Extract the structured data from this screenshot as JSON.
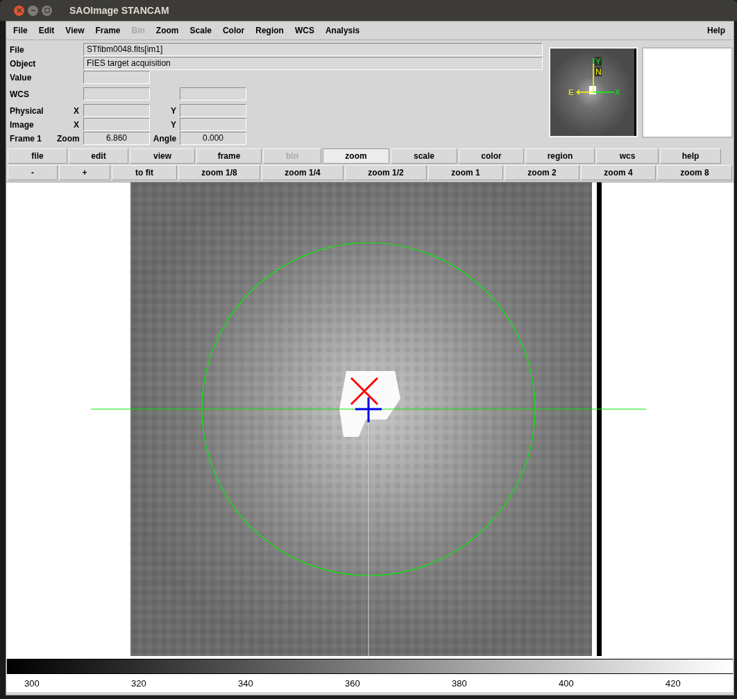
{
  "window": {
    "title": "SAOImage STANCAM"
  },
  "menu": [
    {
      "label": "File",
      "disabled": false
    },
    {
      "label": "Edit",
      "disabled": false
    },
    {
      "label": "View",
      "disabled": false
    },
    {
      "label": "Frame",
      "disabled": false
    },
    {
      "label": "Bin",
      "disabled": true
    },
    {
      "label": "Zoom",
      "disabled": false
    },
    {
      "label": "Scale",
      "disabled": false
    },
    {
      "label": "Color",
      "disabled": false
    },
    {
      "label": "Region",
      "disabled": false
    },
    {
      "label": "WCS",
      "disabled": false
    },
    {
      "label": "Analysis",
      "disabled": false
    }
  ],
  "help_menu": "Help",
  "info": {
    "file": {
      "label": "File",
      "value": "STfibm0048.fits[im1]"
    },
    "object": {
      "label": "Object",
      "value": "FIES target acquisition"
    },
    "value": {
      "label": "Value"
    },
    "wcs": {
      "label": "WCS"
    },
    "physical": {
      "label": "Physical",
      "x": "X",
      "y": "Y"
    },
    "image": {
      "label": "Image",
      "x": "X",
      "y": "Y"
    },
    "frame": {
      "label": "Frame 1",
      "zoom_label": "Zoom",
      "zoom": "6.860",
      "angle_label": "Angle",
      "angle": "0.000"
    }
  },
  "panner": {
    "north": "N",
    "east": "E",
    "x_axis": "X",
    "y_axis": "Y"
  },
  "buttons": [
    {
      "label": "file",
      "selected": false,
      "disabled": false
    },
    {
      "label": "edit",
      "selected": false,
      "disabled": false
    },
    {
      "label": "view",
      "selected": false,
      "disabled": false
    },
    {
      "label": "frame",
      "selected": false,
      "disabled": false
    },
    {
      "label": "bin",
      "selected": false,
      "disabled": true
    },
    {
      "label": "zoom",
      "selected": true,
      "disabled": false
    },
    {
      "label": "scale",
      "selected": false,
      "disabled": false
    },
    {
      "label": "color",
      "selected": false,
      "disabled": false
    },
    {
      "label": "region",
      "selected": false,
      "disabled": false
    },
    {
      "label": "wcs",
      "selected": false,
      "disabled": false
    },
    {
      "label": "help",
      "selected": false,
      "disabled": false
    }
  ],
  "zoom_buttons": [
    "-",
    "+",
    "to fit",
    "zoom 1/8",
    "zoom 1/4",
    "zoom 1/2",
    "zoom 1",
    "zoom 2",
    "zoom 4",
    "zoom 8"
  ],
  "colorbar": {
    "ticks": [
      "300",
      "320",
      "340",
      "360",
      "380",
      "400",
      "420"
    ]
  }
}
